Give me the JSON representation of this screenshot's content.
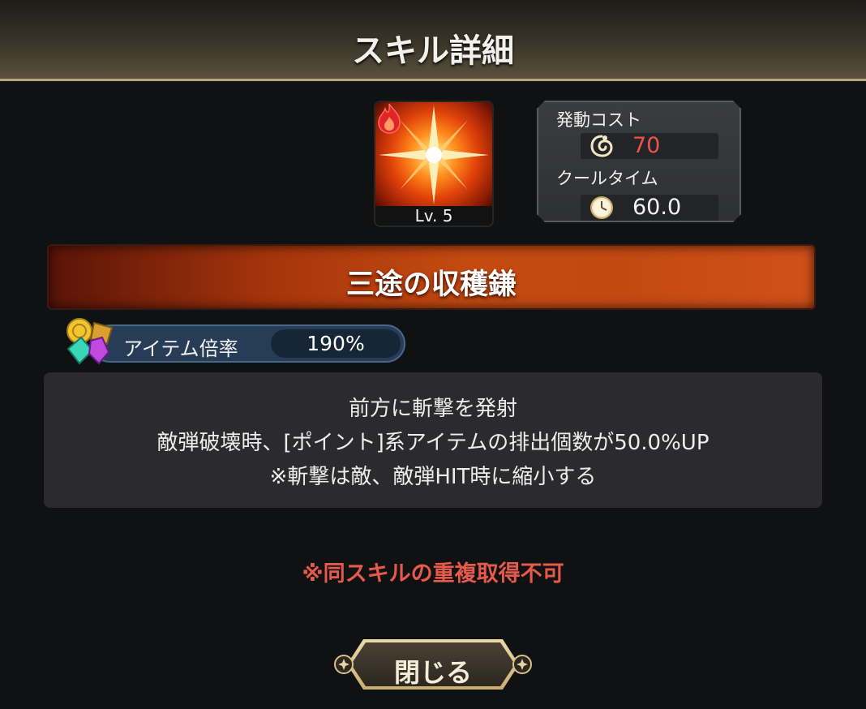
{
  "header": {
    "title": "スキル詳細"
  },
  "skill": {
    "level_label": "Lv. 5",
    "name": "三途の収穫鎌",
    "icon": "starburst-slash-icon",
    "element_icon": "fire-element-icon"
  },
  "stats": {
    "cost_label": "発動コスト",
    "cost_value": "70",
    "cost_icon": "swirl-cost-icon",
    "cooltime_label": "クールタイム",
    "cooltime_value": "60.0",
    "cooltime_icon": "stopwatch-icon"
  },
  "item_rate": {
    "label": "アイテム倍率",
    "value": "190%",
    "icon": "gems-coin-icon"
  },
  "description": {
    "line1": "前方に斬撃を発射",
    "line2": "敵弾破壊時、[ポイント]系アイテムの排出個数が50.0%UP",
    "line3": "※斬撃は敵、敵弾HIT時に縮小する"
  },
  "warning": "※同スキルの重複取得不可",
  "close_button": {
    "label": "閉じる"
  },
  "colors": {
    "cost_value": "#f0524a",
    "warning": "#e55a4a",
    "banner": "#c44a10",
    "header_border": "#b8a57a"
  }
}
